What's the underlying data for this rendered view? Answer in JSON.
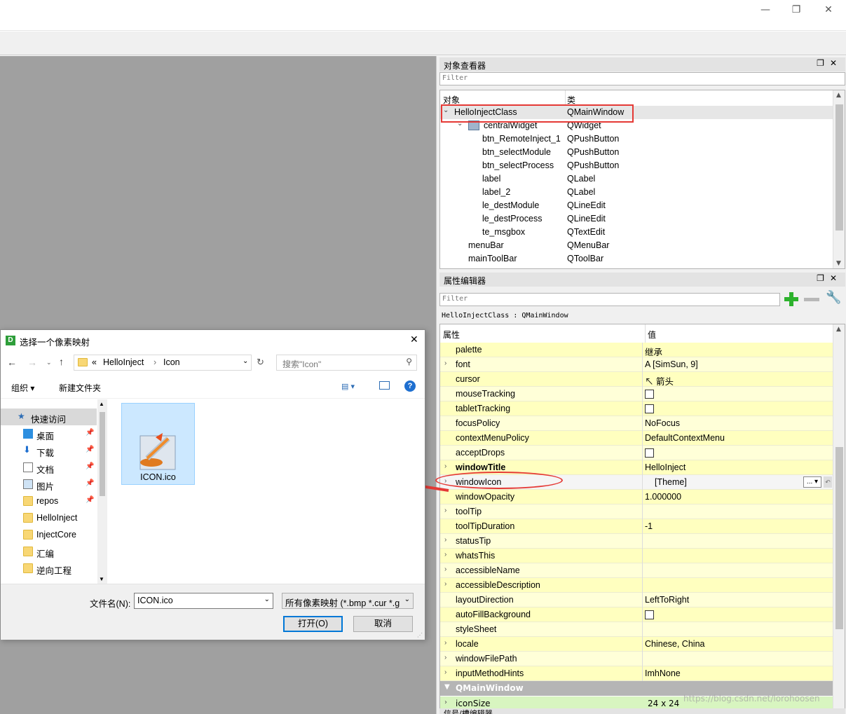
{
  "window": {
    "minimize_glyph": "—",
    "maximize_glyph": "❐",
    "close_glyph": "✕"
  },
  "object_inspector": {
    "title": "对象查看器",
    "filter_placeholder": "Filter",
    "col_object": "对象",
    "col_class": "类",
    "rows": [
      {
        "name": "HelloInjectClass",
        "class": "QMainWindow",
        "level": 0,
        "expanded": true,
        "selected": true
      },
      {
        "name": "centralWidget",
        "class": "QWidget",
        "level": 1,
        "expanded": true
      },
      {
        "name": "btn_RemoteInject_1",
        "class": "QPushButton",
        "level": 2
      },
      {
        "name": "btn_selectModule",
        "class": "QPushButton",
        "level": 2
      },
      {
        "name": "btn_selectProcess",
        "class": "QPushButton",
        "level": 2
      },
      {
        "name": "label",
        "class": "QLabel",
        "level": 2
      },
      {
        "name": "label_2",
        "class": "QLabel",
        "level": 2
      },
      {
        "name": "le_destModule",
        "class": "QLineEdit",
        "level": 2
      },
      {
        "name": "le_destProcess",
        "class": "QLineEdit",
        "level": 2
      },
      {
        "name": "te_msgbox",
        "class": "QTextEdit",
        "level": 2
      },
      {
        "name": "menuBar",
        "class": "QMenuBar",
        "level": 1
      },
      {
        "name": "mainToolBar",
        "class": "QToolBar",
        "level": 1
      }
    ]
  },
  "property_editor": {
    "title": "属性编辑器",
    "filter_placeholder": "Filter",
    "context": "HelloInjectClass : QMainWindow",
    "col_property": "属性",
    "col_value": "值",
    "rows": [
      {
        "name": "palette",
        "value": "继承",
        "expandable": false
      },
      {
        "name": "font",
        "value": "[SimSun, 9]",
        "expandable": true,
        "icon": "font-icon",
        "icon_glyph": "A"
      },
      {
        "name": "cursor",
        "value": "箭头",
        "expandable": false,
        "icon": "cursor-arrow-icon",
        "icon_glyph": "↖"
      },
      {
        "name": "mouseTracking",
        "value": "",
        "expandable": false,
        "checkbox": true
      },
      {
        "name": "tabletTracking",
        "value": "",
        "expandable": false,
        "checkbox": true
      },
      {
        "name": "focusPolicy",
        "value": "NoFocus",
        "expandable": false
      },
      {
        "name": "contextMenuPolicy",
        "value": "DefaultContextMenu",
        "expandable": false
      },
      {
        "name": "acceptDrops",
        "value": "",
        "expandable": false,
        "checkbox": true
      },
      {
        "name": "windowTitle",
        "value": "HelloInject",
        "expandable": true,
        "bold": true
      },
      {
        "name": "windowIcon",
        "value": "[Theme]",
        "expandable": true,
        "editing": true
      },
      {
        "name": "windowOpacity",
        "value": "1.000000",
        "expandable": false
      },
      {
        "name": "toolTip",
        "value": "",
        "expandable": true
      },
      {
        "name": "toolTipDuration",
        "value": "-1",
        "expandable": false
      },
      {
        "name": "statusTip",
        "value": "",
        "expandable": true
      },
      {
        "name": "whatsThis",
        "value": "",
        "expandable": true
      },
      {
        "name": "accessibleName",
        "value": "",
        "expandable": true
      },
      {
        "name": "accessibleDescription",
        "value": "",
        "expandable": true
      },
      {
        "name": "layoutDirection",
        "value": "LeftToRight",
        "expandable": false
      },
      {
        "name": "autoFillBackground",
        "value": "",
        "expandable": false,
        "checkbox": true
      },
      {
        "name": "styleSheet",
        "value": "",
        "expandable": false
      },
      {
        "name": "locale",
        "value": "Chinese, China",
        "expandable": true
      },
      {
        "name": "windowFilePath",
        "value": "",
        "expandable": true
      },
      {
        "name": "inputMethodHints",
        "value": "ImhNone",
        "expandable": true
      }
    ],
    "section": "QMainWindow",
    "partial_row": {
      "name": "iconSize",
      "value": "24 x 24"
    },
    "edit_button": "...",
    "next_panel_title": "信号/槽编辑器"
  },
  "dialog": {
    "title": "选择一个像素映射",
    "logo_letter": "D",
    "path_prefix": "«",
    "path": [
      "HelloInject",
      "Icon"
    ],
    "search_placeholder": "搜索\"Icon\"",
    "organize": "组织",
    "new_folder": "新建文件夹",
    "quick_access": "快速访问",
    "nav_items": [
      {
        "label": "桌面",
        "icon": "desktop-icon",
        "pinned": true
      },
      {
        "label": "下载",
        "icon": "download-icon",
        "pinned": true
      },
      {
        "label": "文档",
        "icon": "document-icon",
        "pinned": true
      },
      {
        "label": "图片",
        "icon": "pictures-icon",
        "pinned": true
      },
      {
        "label": "repos",
        "icon": "folder-icon",
        "pinned": true
      },
      {
        "label": "HelloInject",
        "icon": "folder-icon",
        "pinned": false
      },
      {
        "label": "InjectCore",
        "icon": "folder-icon",
        "pinned": false
      },
      {
        "label": "汇编",
        "icon": "folder-icon",
        "pinned": false
      },
      {
        "label": "逆向工程",
        "icon": "folder-icon",
        "pinned": false
      }
    ],
    "file": {
      "name": "ICON.ico",
      "icon": "syringe-icon"
    },
    "filename_label": "文件名(N):",
    "filename_value": "ICON.ico",
    "filetype_value": "所有像素映射 (*.bmp *.cur *.g",
    "open_button": "打开(O)",
    "cancel_button": "取消"
  },
  "colors": {
    "highlight_red": "#e53935",
    "prop_yellow": "#ffffbf",
    "selection_blue": "#cce8ff",
    "canvas_gray": "#a0a0a0"
  },
  "watermark": "https://blog.csdn.net/lorohoosen"
}
